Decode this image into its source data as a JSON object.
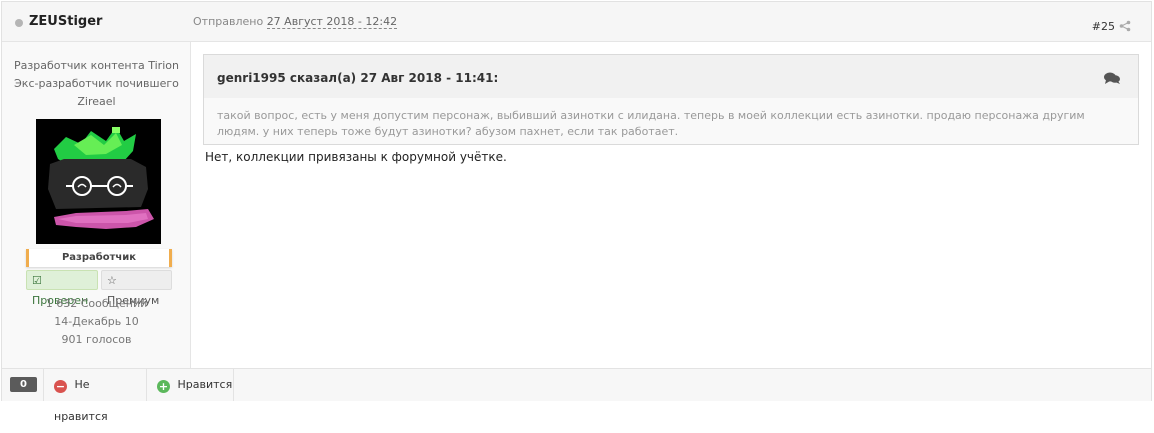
{
  "header": {
    "author": "ZEUStiger",
    "posted_prefix": "Отправлено",
    "posted_date": "27 Август 2018 - 12:42",
    "post_number": "#25"
  },
  "sidebar": {
    "title_lines": [
      "Разработчик контента Tirion",
      "Экс-разработчик почившего",
      "Zireael"
    ],
    "rank": "Разработчик",
    "badge_verified": "Проверен",
    "badge_premium": "Премиум",
    "posts": "1 632 Сообщений",
    "joined": "14-Декабрь 10",
    "votes": "901 голосов"
  },
  "quote": {
    "author_line": "genri1995 сказал(а) 27 Авг 2018 - 11:41:",
    "text": "такой вопрос, есть у меня допустим персонаж, выбивший азинотки  с илидана. теперь в моей коллекции есть азинотки. продаю персонажа другим людям. у них теперь тоже будут азинотки? абузом пахнет, если так работает."
  },
  "reply": "Нет, коллекции привязаны к форумной учётке.",
  "footer": {
    "count": "0",
    "dislike": "Не нравится",
    "like": "Нравится"
  },
  "colors": {
    "dislike": "#d9534f",
    "like": "#5cb85c",
    "rank_accent": "#f0ad4e"
  }
}
